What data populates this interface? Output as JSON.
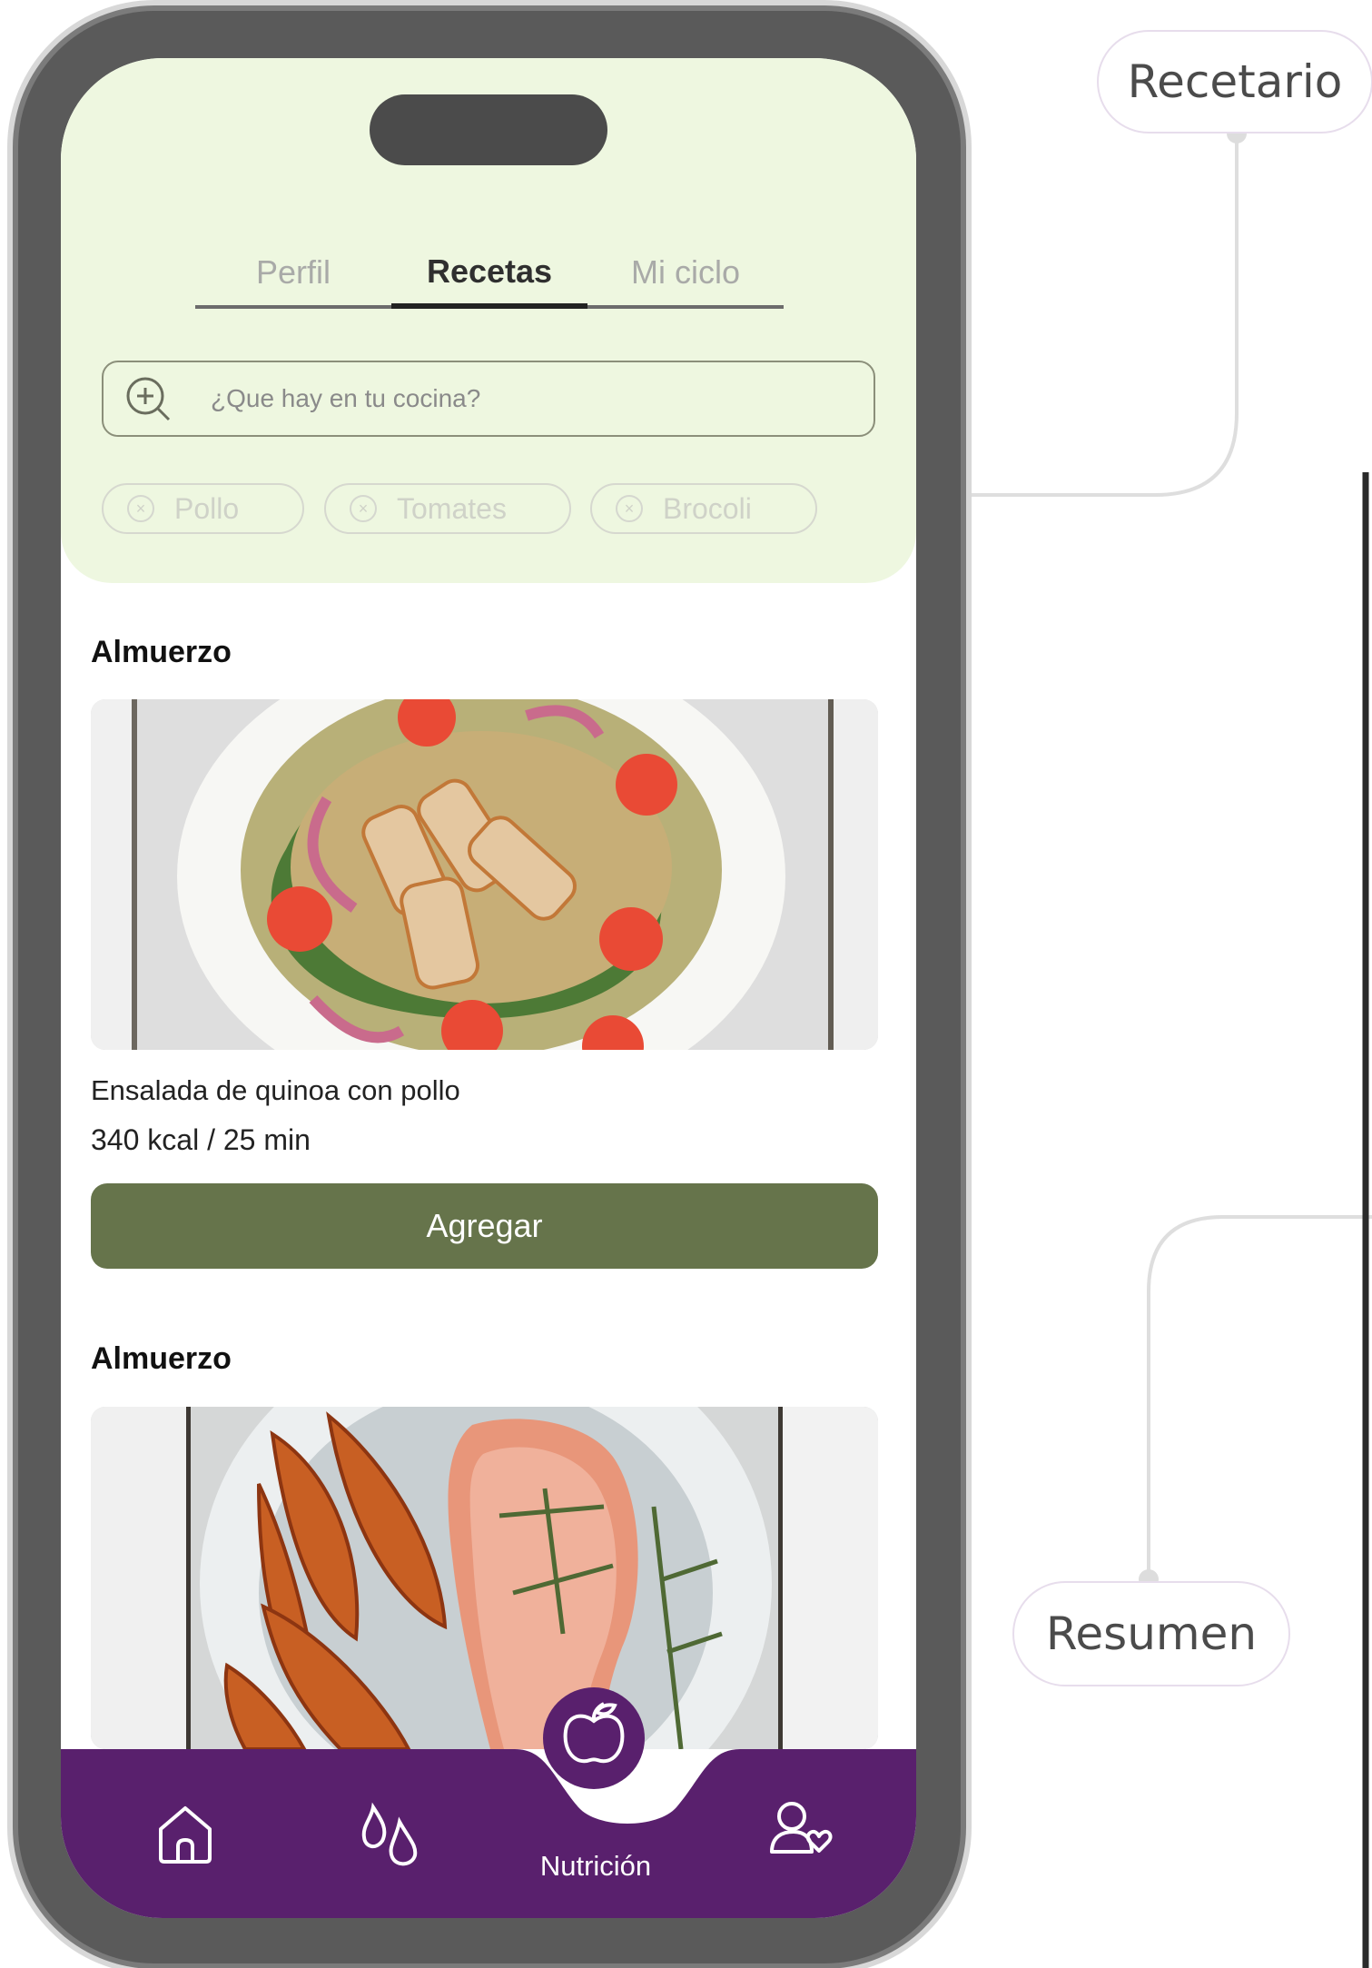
{
  "annotations": {
    "recetario": "Recetario",
    "resumen": "Resumen"
  },
  "tabs": [
    {
      "label": "Perfil",
      "active": false
    },
    {
      "label": "Recetas",
      "active": true
    },
    {
      "label": "Mi ciclo",
      "active": false
    }
  ],
  "search": {
    "placeholder": "¿Que hay en tu cocina?"
  },
  "chips": [
    {
      "label": "Pollo"
    },
    {
      "label": "Tomates"
    },
    {
      "label": "Brocoli"
    }
  ],
  "recipes": [
    {
      "meal": "Almuerzo",
      "name": "Ensalada de quinoa con pollo",
      "meta": "340 kcal / 25 min",
      "button": "Agregar"
    },
    {
      "meal": "Almuerzo"
    }
  ],
  "bottom_nav": {
    "items": [
      {
        "icon": "home-icon"
      },
      {
        "icon": "drops-icon"
      },
      {
        "icon": "apple-icon",
        "label": "Nutrición"
      },
      {
        "icon": "user-heart-icon"
      }
    ]
  },
  "colors": {
    "header_bg": "#eef7e0",
    "primary_green": "#66744b",
    "nav_purple": "#59206d",
    "annotation_border": "#e7ddec"
  }
}
